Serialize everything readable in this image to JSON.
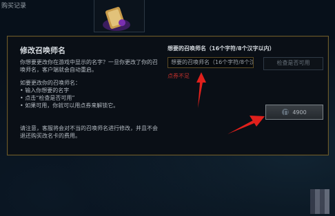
{
  "header": {
    "tab_label": "购买记录"
  },
  "dialog": {
    "title": "修改召唤师名",
    "intro": "你想要更改你在游戏中显示的名字？一旦你更改了你的召唤师名，客户端就会自动重启。",
    "steps_heading": "如要更改你的召唤师名：",
    "steps": [
      "输入你想要的名字",
      "点击“检查是否可用”",
      "如果可用，你就可以用点券来解锁它。"
    ],
    "notice": "请注意，客服将会对不当的召唤师名进行修改，并且不会退还购买改名卡的费用。",
    "name_label": "想要的召唤师名（16个字符/8个汉字以内）",
    "name_input_value": "想要的召唤师名（16个字符/8个汉",
    "error_text": "点券不足",
    "check_button_label": "检查是否可用",
    "buy_button_label": "4900"
  },
  "colors": {
    "border_gold": "#6b5a2c",
    "error_red": "#c2302c",
    "arrow_red": "#e0201c"
  }
}
